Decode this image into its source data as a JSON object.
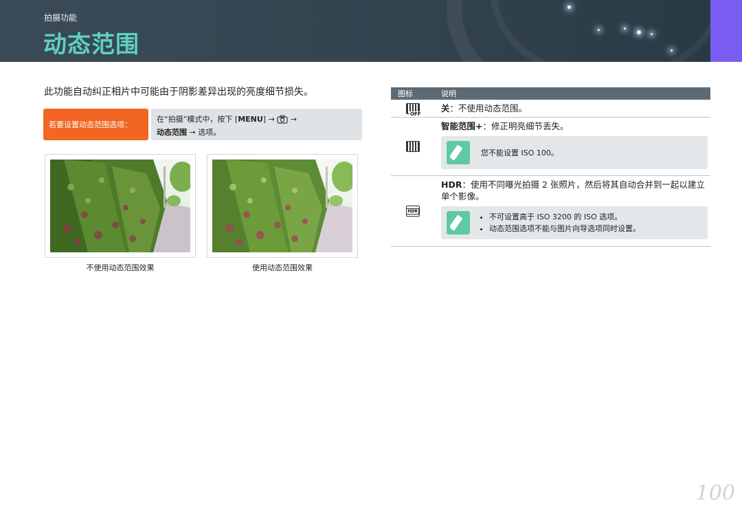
{
  "header": {
    "section_label": "拍摄功能",
    "title": "动态范围",
    "colors": {
      "title": "#5fd0c2",
      "accent": "#7b5cf0",
      "banner": "#34444f"
    }
  },
  "intro": "此功能自动纠正相片中可能由于阴影差异出现的亮度细节损失。",
  "howto": {
    "label": "若要设置动态范围选项：",
    "line1_prefix": "在“拍摄”模式中，按下 [",
    "menu_key": "MENU",
    "line1_suffix": "] → ",
    "camera_icon": "camera-icon",
    "line1_arrow": " →",
    "line2_bold": "动态范围",
    "line2_rest": " → 选项。",
    "colors": {
      "label_bg": "#f26522",
      "steps_bg": "#dfe3e6"
    }
  },
  "photos": [
    {
      "caption": "不使用动态范围效果"
    },
    {
      "caption": "使用动态范围效果"
    }
  ],
  "table": {
    "headers": [
      "图标",
      "说明"
    ],
    "rows": [
      {
        "icon": "dr-off-icon",
        "icon_text": "OFF",
        "name": "关",
        "desc": "：不使用动态范围。"
      },
      {
        "icon": "dr-smart-icon",
        "name": "智能范围+",
        "desc": "：修正明亮细节丢失。",
        "notes": [
          "您不能设置 ISO 100。"
        ]
      },
      {
        "icon": "hdr-icon",
        "icon_text": "HDR",
        "name": "HDR",
        "desc": "：使用不同曝光拍摄 2 张照片，然后将其自动合并到一起以建立单个影像。",
        "notes": [
          "不可设置高于 ISO 3200 的 ISO 选项。",
          "动态范围选项不能与图片向导选项同时设置。"
        ]
      }
    ]
  },
  "page_number": "100"
}
